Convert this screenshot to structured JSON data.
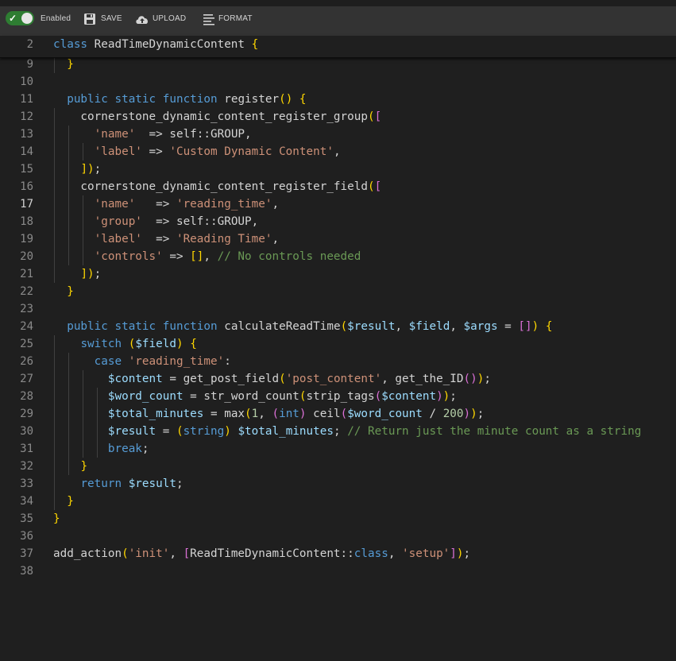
{
  "toolbar": {
    "toggle_label": "Enabled",
    "save_label": "SAVE",
    "upload_label": "UPLOAD",
    "format_label": "FORMAT",
    "icons": [
      "check-icon",
      "save-icon",
      "upload-cloud-icon",
      "format-lines-icon"
    ],
    "toggle_color": "#2e7d32"
  },
  "sticky": {
    "line_no": "2",
    "text": "class ReadTimeDynamicContent {"
  },
  "lines": [
    {
      "no": "9",
      "text": "  }"
    },
    {
      "no": "10",
      "text": ""
    },
    {
      "no": "11",
      "text": "  public static function register() {"
    },
    {
      "no": "12",
      "text": "    cornerstone_dynamic_content_register_group(["
    },
    {
      "no": "13",
      "text": "      'name'  => self::GROUP,"
    },
    {
      "no": "14",
      "text": "      'label' => 'Custom Dynamic Content',"
    },
    {
      "no": "15",
      "text": "    ]);"
    },
    {
      "no": "16",
      "text": "    cornerstone_dynamic_content_register_field(["
    },
    {
      "no": "17",
      "text": "      'name'   => 'reading_time',"
    },
    {
      "no": "18",
      "text": "      'group'  => self::GROUP,"
    },
    {
      "no": "19",
      "text": "      'label'  => 'Reading Time',"
    },
    {
      "no": "20",
      "text": "      'controls' => [], // No controls needed"
    },
    {
      "no": "21",
      "text": "    ]);"
    },
    {
      "no": "22",
      "text": "  }"
    },
    {
      "no": "23",
      "text": ""
    },
    {
      "no": "24",
      "text": "  public static function calculateReadTime($result, $field, $args = []) {"
    },
    {
      "no": "25",
      "text": "    switch ($field) {"
    },
    {
      "no": "26",
      "text": "      case 'reading_time':"
    },
    {
      "no": "27",
      "text": "        $content = get_post_field('post_content', get_the_ID());"
    },
    {
      "no": "28",
      "text": "        $word_count = str_word_count(strip_tags($content));"
    },
    {
      "no": "29",
      "text": "        $total_minutes = max(1, (int) ceil($word_count / 200));"
    },
    {
      "no": "30",
      "text": "        $result = (string) $total_minutes; // Return just the minute count as a string"
    },
    {
      "no": "31",
      "text": "        break;"
    },
    {
      "no": "32",
      "text": "    }"
    },
    {
      "no": "33",
      "text": "    return $result;"
    },
    {
      "no": "34",
      "text": "  }"
    },
    {
      "no": "35",
      "text": "}"
    },
    {
      "no": "36",
      "text": ""
    },
    {
      "no": "37",
      "text": "add_action('init', [ReadTimeDynamicContent::class, 'setup']);"
    },
    {
      "no": "38",
      "text": ""
    }
  ],
  "active_line": "17",
  "colors": {
    "background": "#1f1f1f",
    "toolbar": "#333333",
    "keyword": "#569cd6",
    "string": "#ce9178",
    "comment": "#6a9955",
    "variable": "#9cdcfe",
    "number": "#b5cea8"
  }
}
